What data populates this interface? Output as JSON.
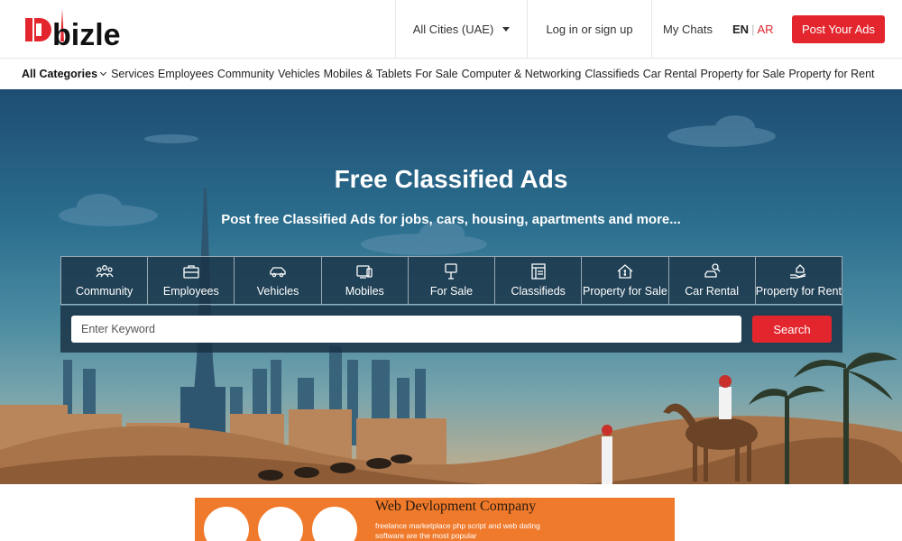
{
  "header": {
    "logo_text": "Dbizle",
    "city_selector": "All Cities (UAE)",
    "login": "Log in or sign up",
    "chats": "My Chats",
    "lang_en": "EN",
    "lang_ar": "AR",
    "post_button": "Post Your Ads"
  },
  "nav": {
    "all_categories": "All Categories",
    "items": [
      "Services",
      "Employees",
      "Community",
      "Vehicles",
      "Mobiles & Tablets",
      "For Sale",
      "Computer & Networking",
      "Classifieds",
      "Car Rental",
      "Property for Sale",
      "Property for Rent"
    ]
  },
  "hero": {
    "title": "Free Classified Ads",
    "subtitle": "Post free Classified Ads for jobs, cars, housing, apartments and more...",
    "categories": [
      {
        "label": "Community",
        "icon": "community-icon"
      },
      {
        "label": "Employees",
        "icon": "briefcase-icon"
      },
      {
        "label": "Vehicles",
        "icon": "car-icon"
      },
      {
        "label": "Mobiles",
        "icon": "mobile-icon"
      },
      {
        "label": "For Sale",
        "icon": "for-sale-sign-icon"
      },
      {
        "label": "Classifieds",
        "icon": "classifieds-icon"
      },
      {
        "label": "Property for Sale",
        "icon": "house-dollar-icon"
      },
      {
        "label": "Car Rental",
        "icon": "car-rental-icon"
      },
      {
        "label": "Property for Rent",
        "icon": "hand-house-icon"
      }
    ],
    "search_placeholder": "Enter Keyword",
    "search_button": "Search"
  },
  "banner": {
    "title": "Web Devlopment Company",
    "line1": "freelance marketplace php script and web dating",
    "line2": "software are the most popular"
  },
  "colors": {
    "brand_red": "#e3262d",
    "hero_sky": "#1e4d73"
  }
}
